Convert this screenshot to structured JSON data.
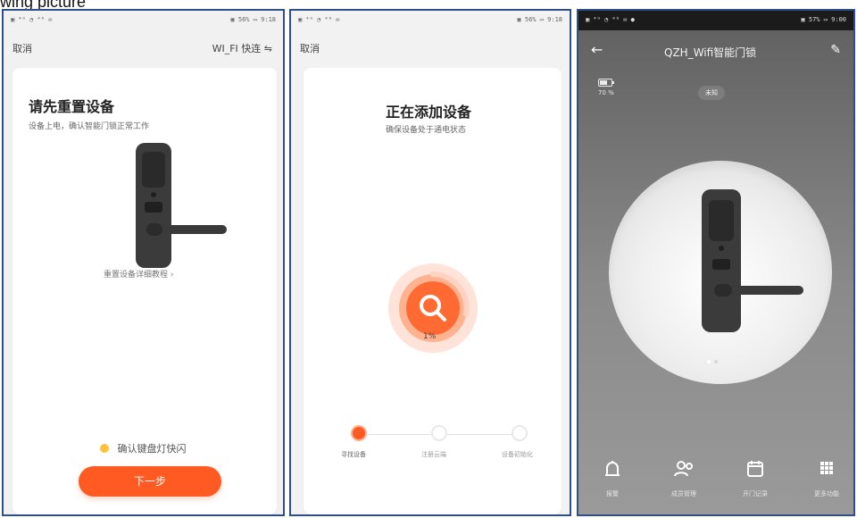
{
  "caption": "wing picture",
  "panels": [
    {
      "status": {
        "left": "▣ ⁴ᴳ ◔ ⁴⁶ ✉",
        "right": "▣ 56% ▭ 9:18"
      },
      "topbar": {
        "cancel": "取消",
        "wifi": "WI_FI 快连 ⇋"
      },
      "title": "请先重置设备",
      "subtitle": "设备上电，确认智能门锁正常工作",
      "help_link": "重置设备详细教程 ›",
      "check_text": "确认键盘灯快闪",
      "next_button": "下一步"
    },
    {
      "status": {
        "left": "▣ ⁴ᴳ ◔ ⁴⁶ ✉",
        "right": "▣ 56% ▭ 9:18"
      },
      "topbar": {
        "cancel": "取消"
      },
      "title": "正在添加设备",
      "subtitle": "确保设备处于通电状态",
      "progress_text": "1%",
      "progress_value": 0.01,
      "steps": [
        {
          "label": "寻找设备"
        },
        {
          "label": "注册云端"
        },
        {
          "label": "设备初始化"
        }
      ]
    },
    {
      "status": {
        "left": "▣ ⁴ᴳ ◔ ⁴⁶ ✉ ●",
        "right": "▣ 57% ▭ 9:00"
      },
      "header": {
        "back": "←",
        "title": "QZH_Wifi智能门锁",
        "edit": "✎"
      },
      "battery_text": "70 %",
      "battery_level": 0.7,
      "state_badge": "未知",
      "bottom_nav": [
        {
          "icon": "alarm-icon",
          "label": "报警"
        },
        {
          "icon": "users-icon",
          "label": "成员管理"
        },
        {
          "icon": "calendar-icon",
          "label": "开门记录"
        },
        {
          "icon": "grid-icon",
          "label": "更多功能"
        }
      ]
    }
  ],
  "colors": {
    "accent": "#ff5a21",
    "accent_light": "#ffb290",
    "frame": "#2f4f86",
    "panel_bg": "#f2f2f2",
    "dark_bg_top": "#5f5f5f",
    "dark_bg_bottom": "#9a9a9a"
  }
}
